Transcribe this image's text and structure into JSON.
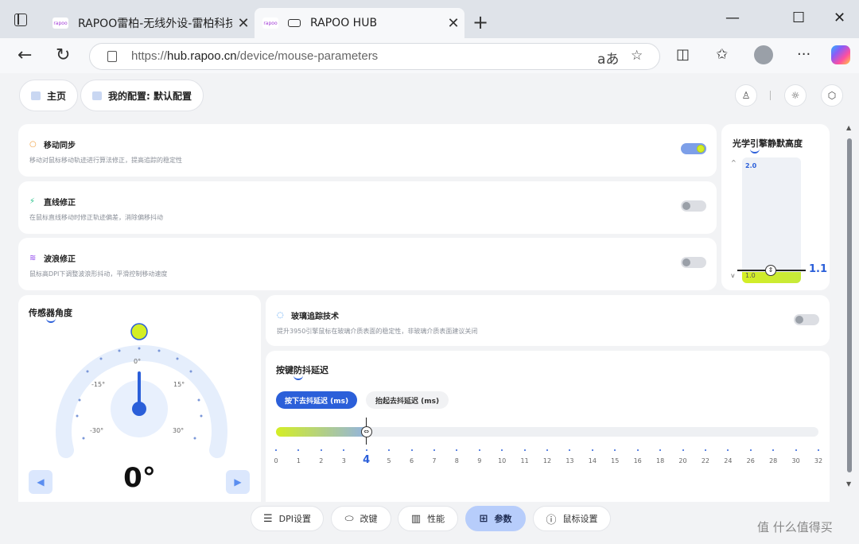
{
  "browser": {
    "tabs": [
      {
        "title": "RAPOO雷柏-无线外设-雷柏科技",
        "favicon_text": "rapoo",
        "close": "✕"
      },
      {
        "title": "RAPOO HUB",
        "favicon_text": "rapoo",
        "close": "✕"
      }
    ],
    "new_tab": "+",
    "window_controls": {
      "minimize": "—",
      "maximize": "☐",
      "close": "✕"
    },
    "url_prefix": "https://",
    "url_host": "hub.rapoo.cn",
    "url_path": "/device/mouse-parameters",
    "read_aloud": "aあ"
  },
  "header": {
    "home_label": "主页",
    "profile_label": "我的配置: 默认配置"
  },
  "settings_rows": [
    {
      "title": "移动同步",
      "desc": "移动对鼠标移动轨迹进行算法修正，提高追踪的稳定性",
      "icon_color": "#f0a040",
      "enabled": true
    },
    {
      "title": "直线修正",
      "desc": "在鼠标直线移动时修正轨迹偏差，消除偏移抖动",
      "icon_color": "#27c28a",
      "enabled": false
    },
    {
      "title": "波浪修正",
      "desc": "鼠标高DPI下调整波浪形抖动，平滑控制移动速度",
      "icon_color": "#a66cf0",
      "enabled": false
    }
  ],
  "optical": {
    "title": "光学引擎静默高度",
    "max_label": "2.0",
    "min_label": "1.0",
    "up": "^",
    "down": "v",
    "value": "1.1",
    "level": 0.1
  },
  "sensor": {
    "title": "传感器角度",
    "labels": [
      "0°",
      "-15°",
      "15°",
      "-30°",
      "30°"
    ],
    "value": "0°",
    "angle": 0
  },
  "glass": {
    "title": "玻璃追踪技术",
    "desc": "提升3950引擎鼠标在玻璃介质表面的稳定性，非玻璃介质表面建议关闭",
    "enabled": false
  },
  "debounce": {
    "title": "按键防抖延迟",
    "tab_press": "按下去抖延迟 (ms)",
    "tab_release": "抬起去抖延迟 (ms)",
    "ticks": [
      "0",
      "1",
      "2",
      "3",
      "4",
      "5",
      "6",
      "7",
      "8",
      "9",
      "10",
      "11",
      "12",
      "13",
      "14",
      "15",
      "16",
      "18",
      "20",
      "22",
      "24",
      "26",
      "28",
      "30",
      "32"
    ],
    "value": 4
  },
  "bottom_nav": [
    {
      "label": "DPI设置",
      "icon": "bars-icon",
      "active": false
    },
    {
      "label": "改键",
      "icon": "mouse-icon",
      "active": false
    },
    {
      "label": "性能",
      "icon": "chart-icon",
      "active": false
    },
    {
      "label": "参数",
      "icon": "grid-icon",
      "active": true
    },
    {
      "label": "鼠标设置",
      "icon": "info-icon",
      "active": false
    }
  ],
  "watermark": "值 什么值得买"
}
